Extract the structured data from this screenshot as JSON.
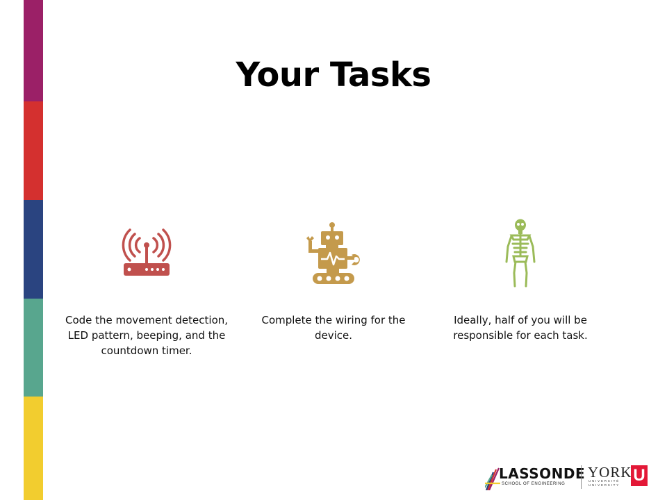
{
  "slide": {
    "title": "Your Tasks"
  },
  "side_bar_colors": [
    "#9b2067",
    "#d4302f",
    "#2a4480",
    "#58a68e",
    "#f2cd2f"
  ],
  "tasks": [
    {
      "icon": "wifi-router-icon",
      "color": "#c0504d",
      "caption": "Code the movement detection, LED pattern, beeping, and the countdown timer."
    },
    {
      "icon": "robot-icon",
      "color": "#c49a4c",
      "caption": "Complete the wiring for the device."
    },
    {
      "icon": "skeleton-icon",
      "color": "#9bbb59",
      "caption": "Ideally, half of you will be responsible for each task."
    }
  ],
  "logo": {
    "lassonde": "LASSONDE",
    "lassonde_sub": "SCHOOL OF ENGINEERING",
    "york": "YORK",
    "york_sub": "UNIVERSITÉ UNIVERSITY",
    "york_u": "U"
  }
}
